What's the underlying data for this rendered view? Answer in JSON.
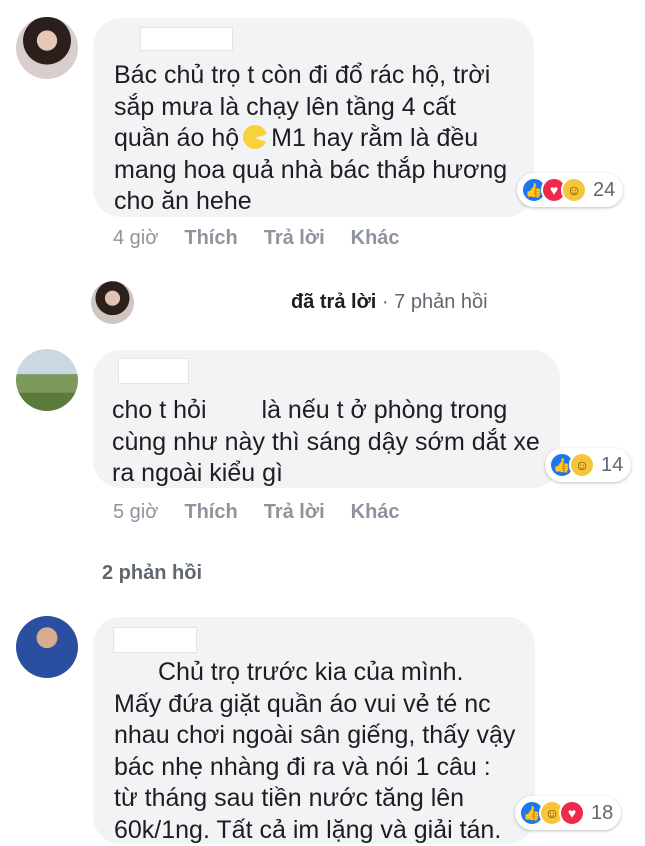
{
  "comments": [
    {
      "text_lines": [
        "Bác chủ trọ t còn đi đổ rác hộ, trời",
        "sắp mưa là chạy lên tầng 4 cất",
        "quần áo hộ",
        "M1 hay rằm là đều",
        "mang hoa quả nhà bác thắp hương",
        "cho ăn hehe"
      ],
      "reactions": {
        "icons": [
          "like-icon",
          "love-icon",
          "haha-icon"
        ],
        "count": "24"
      },
      "actions": {
        "time": "4 giờ",
        "like": "Thích",
        "reply": "Trả lời",
        "more": "Khác"
      }
    },
    {
      "text_lines": [
        "cho t hỏi",
        "là nếu t ở phòng trong",
        "cùng như này thì sáng dậy sớm dắt xe",
        "ra ngoài kiểu gì"
      ],
      "reactions": {
        "icons": [
          "like-icon",
          "haha-icon"
        ],
        "count": "14"
      },
      "actions": {
        "time": "5 giờ",
        "like": "Thích",
        "reply": "Trả lời",
        "more": "Khác"
      }
    },
    {
      "text_lines": [
        "Chủ trọ trước kia của mình.",
        "Mấy đứa giặt quần áo vui vẻ té nc",
        "nhau chơi ngoài sân giếng, thấy vậy",
        "bác nhẹ nhàng đi ra và nói 1 câu :",
        "từ tháng sau tiền nước tăng lên",
        "60k/1ng. Tất cả im lặng và giải tán."
      ],
      "reactions": {
        "icons": [
          "like-icon",
          "haha-icon",
          "love-icon"
        ],
        "count": "18"
      }
    }
  ],
  "reply_summary": {
    "replied": "đã trả lời",
    "separator": "·",
    "count_text": "7 phản hồi"
  },
  "more_replies": "2 phản hồi"
}
